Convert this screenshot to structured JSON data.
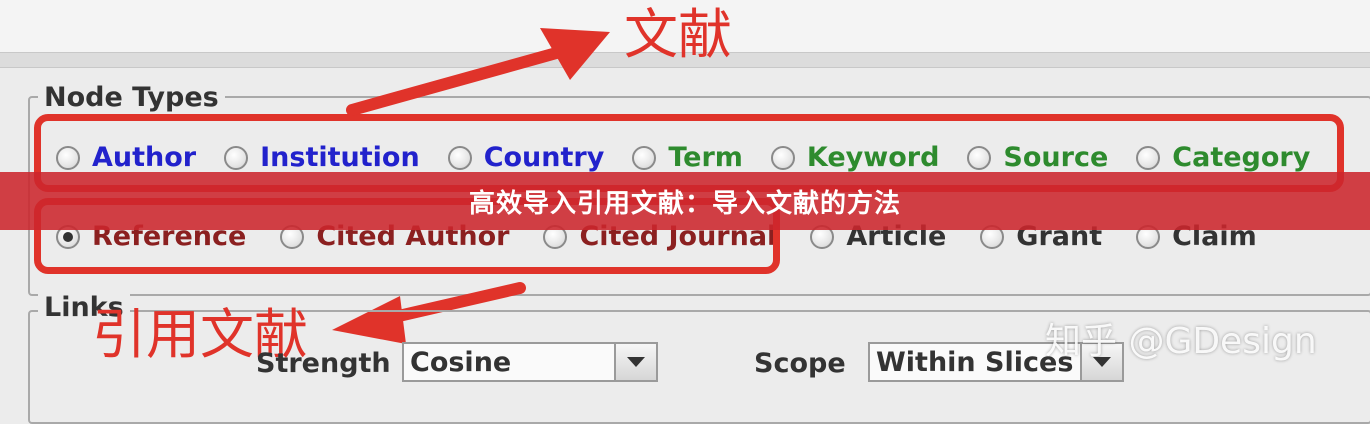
{
  "annotations": {
    "top_label": "文献",
    "bottom_label": "引用文献"
  },
  "banner": {
    "text": "高效导入引用文献：导入文献的方法"
  },
  "node_types": {
    "title": "Node Types",
    "row1": [
      {
        "label": "Author",
        "color": "#2222cc",
        "checked": false
      },
      {
        "label": "Institution",
        "color": "#2222cc",
        "checked": false
      },
      {
        "label": "Country",
        "color": "#2222cc",
        "checked": false
      },
      {
        "label": "Term",
        "color": "#2e8b2e",
        "checked": false
      },
      {
        "label": "Keyword",
        "color": "#2e8b2e",
        "checked": false
      },
      {
        "label": "Source",
        "color": "#2e8b2e",
        "checked": false
      },
      {
        "label": "Category",
        "color": "#2e8b2e",
        "checked": false
      }
    ],
    "row2": [
      {
        "label": "Reference",
        "color": "#8b2020",
        "checked": true
      },
      {
        "label": "Cited Author",
        "color": "#8b2020",
        "checked": false
      },
      {
        "label": "Cited Journal",
        "color": "#8b2020",
        "checked": false
      },
      {
        "label": "Article",
        "color": "#333333",
        "checked": false
      },
      {
        "label": "Grant",
        "color": "#333333",
        "checked": false
      },
      {
        "label": "Claim",
        "color": "#333333",
        "checked": false
      }
    ]
  },
  "links": {
    "title": "Links",
    "strength_label": "Strength",
    "strength_value": "Cosine",
    "scope_label": "Scope",
    "scope_value": "Within Slices"
  },
  "watermark": "知乎 @GDesign",
  "colors": {
    "annotation_red": "#e0332a",
    "banner_red": "#cc262c"
  }
}
